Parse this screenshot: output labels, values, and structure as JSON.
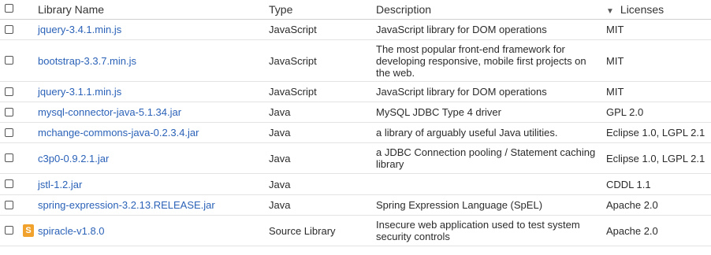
{
  "columns": {
    "name": "Library Name",
    "type": "Type",
    "description": "Description",
    "licenses": "Licenses",
    "sort_icon": "sort-desc-icon"
  },
  "rows": [
    {
      "name": "jquery-3.4.1.min.js",
      "type": "JavaScript",
      "description": "JavaScript library for DOM operations",
      "license": "MIT"
    },
    {
      "name": "bootstrap-3.3.7.min.js",
      "type": "JavaScript",
      "description": "The most popular front-end framework for developing responsive, mobile first projects on the web.",
      "license": "MIT"
    },
    {
      "name": "jquery-3.1.1.min.js",
      "type": "JavaScript",
      "description": "JavaScript library for DOM operations",
      "license": "MIT"
    },
    {
      "name": "mysql-connector-java-5.1.34.jar",
      "type": "Java",
      "description": "MySQL JDBC Type 4 driver",
      "license": "GPL 2.0"
    },
    {
      "name": "mchange-commons-java-0.2.3.4.jar",
      "type": "Java",
      "description": "a library of arguably useful Java utilities.",
      "license": "Eclipse 1.0, LGPL 2.1"
    },
    {
      "name": "c3p0-0.9.2.1.jar",
      "type": "Java",
      "description": "a JDBC Connection pooling / Statement caching library",
      "license": "Eclipse 1.0, LGPL 2.1"
    },
    {
      "name": "jstl-1.2.jar",
      "type": "Java",
      "description": "",
      "license": "CDDL 1.1"
    },
    {
      "name": "spring-expression-3.2.13.RELEASE.jar",
      "type": "Java",
      "description": "Spring Expression Language (SpEL)",
      "license": "Apache 2.0"
    },
    {
      "name": "spiracle-v1.8.0",
      "type": "Source Library",
      "description": "Insecure web application used to test system security controls",
      "license": "Apache 2.0",
      "badge": "S",
      "badge_color": "#f0a22c"
    }
  ],
  "colors": {
    "link": "#2b62b8",
    "text": "#2b2b2b",
    "badge": "#f0a22c"
  }
}
